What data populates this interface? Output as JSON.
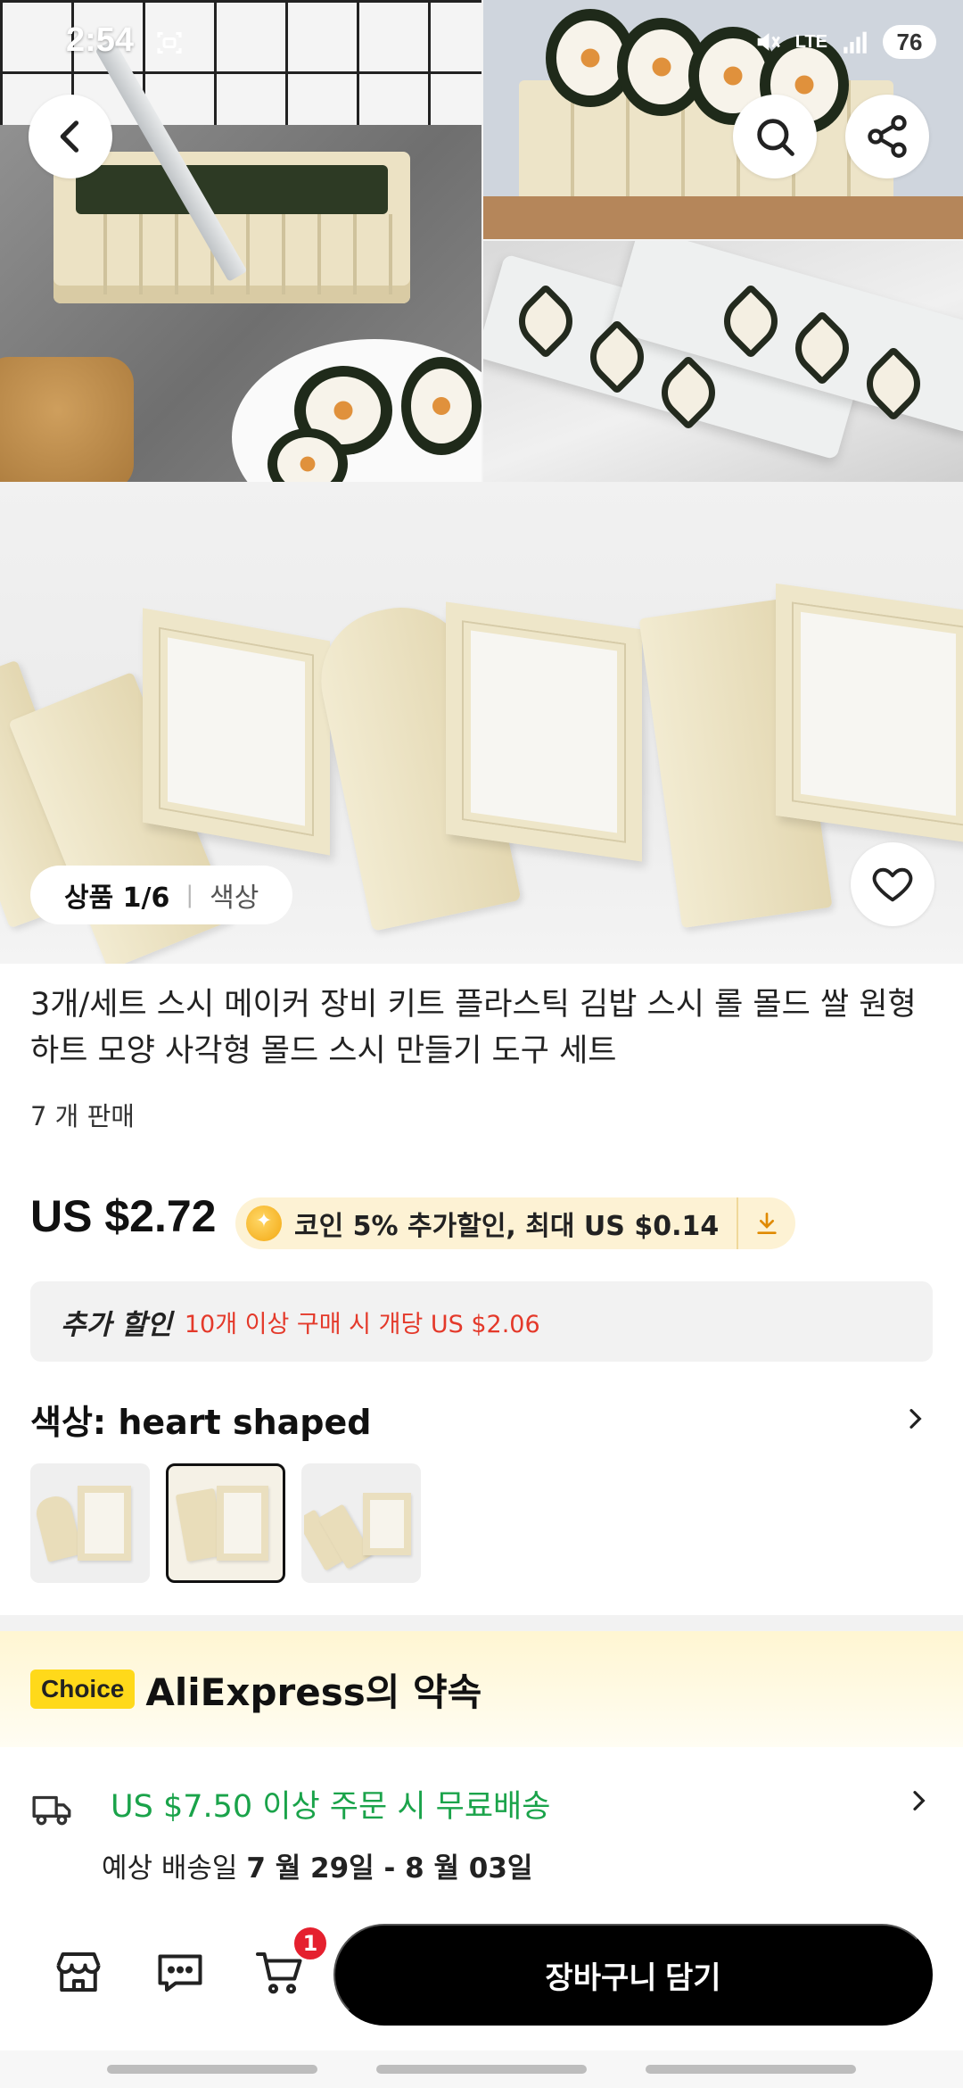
{
  "status_bar": {
    "time": "2:54",
    "network": "LTE",
    "battery": "76"
  },
  "gallery": {
    "counter": "상품 1/6",
    "label": "색상"
  },
  "product": {
    "title": "3개/세트 스시 메이커 장비 키트 플라스틱 김밥 스시 롤 몰드 쌀 원형 하트 모양 사각형 몰드 스시 만들기 도구 세트",
    "sold": "7 개 판매",
    "price": "US $2.72",
    "coin_offer": "코인 5% 추가할인, 최대 US $0.14",
    "extra_discount_label": "추가 할인",
    "extra_discount_detail": "10개 이상 구매 시 개당 US $2.06",
    "color_label": "색상: heart shaped",
    "swatches": [
      "round shaped",
      "heart shaped",
      "square shaped"
    ]
  },
  "choice": {
    "badge": "Choice",
    "title": "AliExpress의 약속"
  },
  "shipping": {
    "free": "US $7.50 이상 주문 시 무료배송",
    "date_prefix": "예상 배송일",
    "date_range": "7 월 29일 - 8 월 03일"
  },
  "bottom_bar": {
    "cart_count": "1",
    "add_to_cart": "장바구니 담기"
  },
  "colors": {
    "accent": "#000000",
    "free_shipping_green": "#1aa34a",
    "discount_red": "#e4392a",
    "choice_yellow": "#ffd91a",
    "badge_red": "#e5202e"
  }
}
